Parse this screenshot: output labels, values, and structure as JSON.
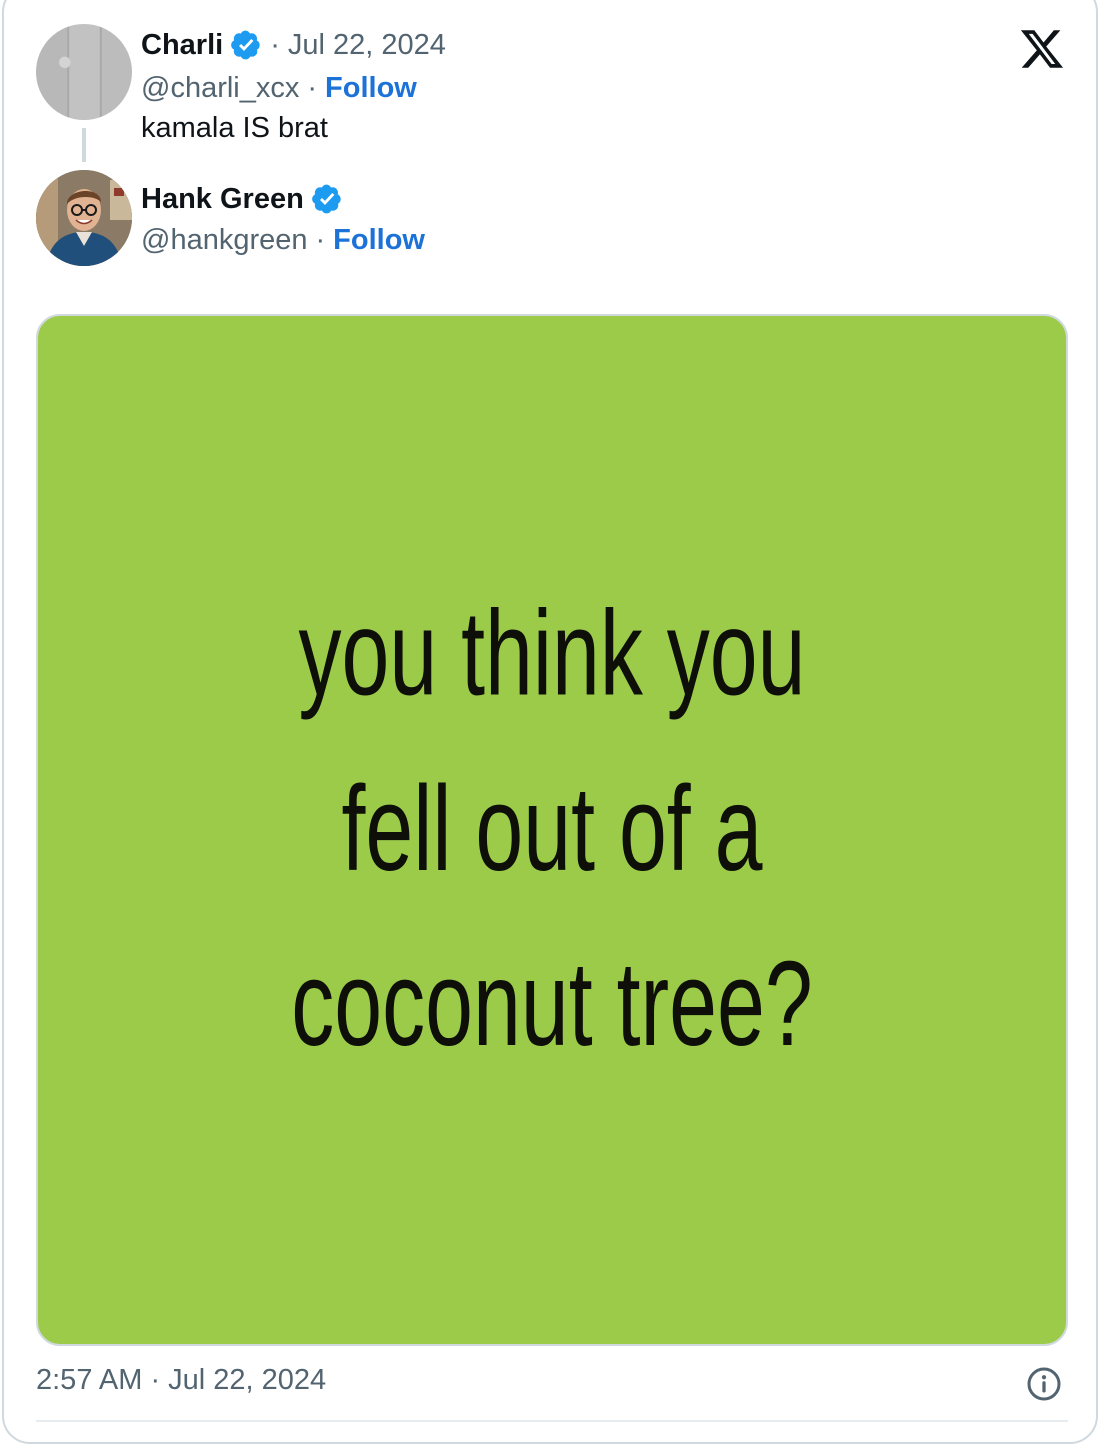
{
  "parent_tweet": {
    "author_name": "Charli",
    "date": "Jul 22, 2024",
    "date_sep": "·",
    "handle": "@charli_xcx",
    "handle_sep": "·",
    "follow_label": "Follow",
    "text": "kamala IS brat",
    "avatar_icon": "avatar-concrete-texture",
    "verified_icon": "verified-badge-icon"
  },
  "main_tweet": {
    "author_name": "Hank Green",
    "handle": "@hankgreen",
    "handle_sep": "·",
    "follow_label": "Follow",
    "avatar_icon": "avatar-photo",
    "verified_icon": "verified-badge-icon",
    "media": {
      "lines": [
        "you think you",
        "fell out of a",
        "coconut tree?"
      ],
      "background_color": "#9ccb4a"
    },
    "timestamp": "2:57 AM · Jul 22, 2024"
  },
  "brand": {
    "logo_icon": "x-logo-icon"
  },
  "colors": {
    "link": "#1d72d8",
    "verified": "#1d9bf0",
    "muted": "#536471"
  }
}
